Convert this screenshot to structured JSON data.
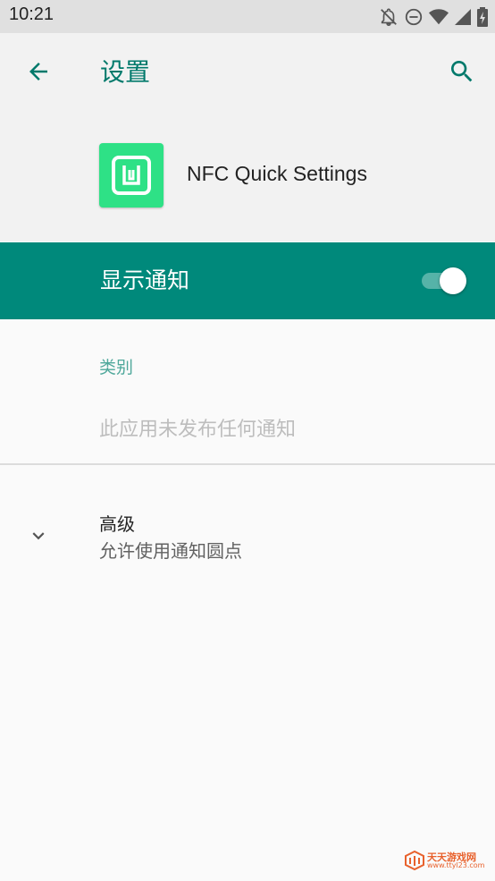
{
  "status_bar": {
    "time": "10:21",
    "icons": [
      "notifications-off-icon",
      "do-not-disturb-icon",
      "wifi-icon",
      "cell-signal-icon",
      "battery-charging-icon"
    ]
  },
  "app_bar": {
    "title": "设置",
    "back_icon": "arrow-back-icon",
    "search_icon": "search-icon"
  },
  "app_info": {
    "name": "NFC Quick Settings",
    "icon": "nfc-app-icon"
  },
  "master_switch": {
    "label": "显示通知",
    "state": "on"
  },
  "category": {
    "header": "类别",
    "empty_text": "此应用未发布任何通知"
  },
  "advanced": {
    "title": "高级",
    "summary": "允许使用通知圆点",
    "icon": "chevron-down-icon"
  },
  "watermark": {
    "title": "天天游戏网",
    "url": "www.ttyl23.com"
  },
  "colors": {
    "accent": "#00796b",
    "switch_bar": "#00897b",
    "app_icon": "#2ee186",
    "background": "#fafafa"
  }
}
